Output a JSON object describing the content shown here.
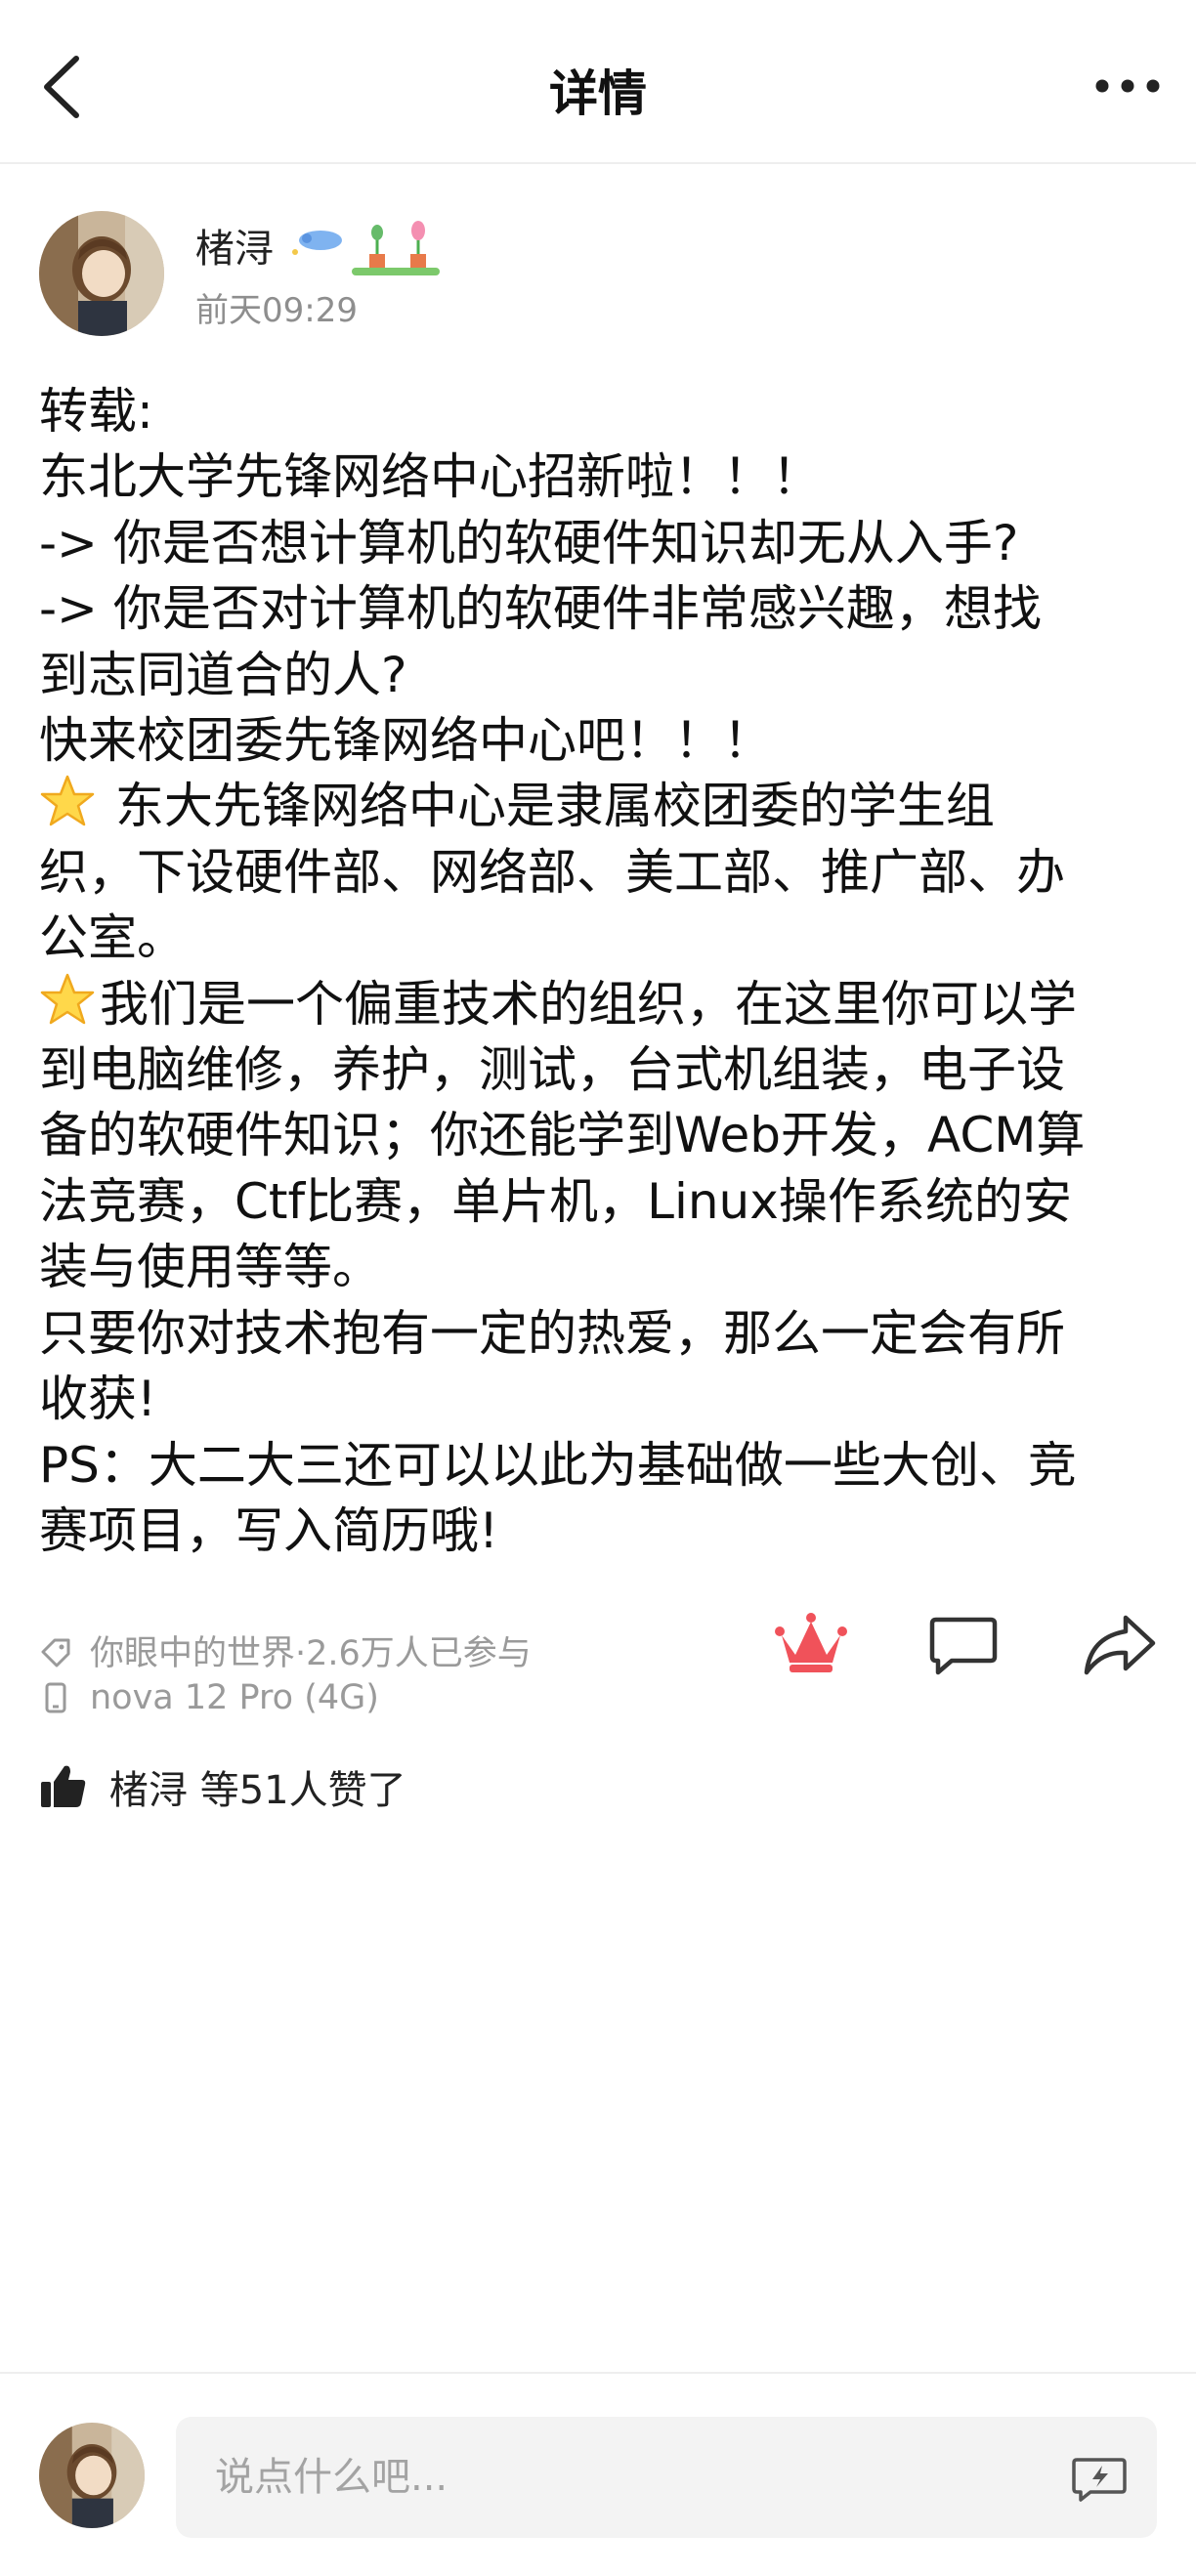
{
  "header": {
    "title": "详情",
    "back_icon": "chevron-left-icon",
    "more_icon": "more-dots-icon"
  },
  "author": {
    "name": "楮浔",
    "time": "前天09:29"
  },
  "post": {
    "lines": [
      "转载:",
      "东北大学先锋网络中心招新啦！！！",
      "-> 你是否想计算机的软硬件知识却无从入手?",
      "-> 你是否对计算机的软硬件非常感兴趣，想找",
      "到志同道合的人?",
      "快来校团委先锋网络中心吧！！！",
      " 东大先锋网络中心是隶属校团委的学生组",
      "织，下设硬件部、网络部、美工部、推广部、办",
      "公室。",
      "我们是一个偏重技术的组织，在这里你可以学",
      "到电脑维修，养护，测试，台式机组装，电子设",
      "备的软硬件知识；你还能学到Web开发，ACM算",
      "法竞赛，Ctf比赛，单片机，Linux操作系统的安",
      "装与使用等等。",
      "只要你对技术抱有一定的热爱，那么一定会有所",
      "收获!",
      "PS：大二大三还可以以此为基础做一些大创、竞",
      "赛项目，写入简历哦!"
    ]
  },
  "meta": {
    "topic": "你眼中的世界·2.6万人已参与",
    "device": "nova 12 Pro (4G)"
  },
  "likes": {
    "text": "楮浔 等51人赞了"
  },
  "comment": {
    "placeholder": "说点什么吧..."
  },
  "colors": {
    "crown_accent": "#f0525a",
    "meta_gray": "#9a9a9a",
    "star_yellow": "#ffd84a"
  }
}
